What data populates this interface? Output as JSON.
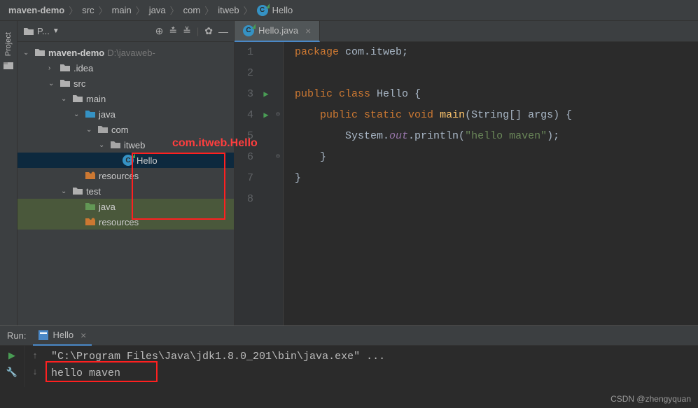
{
  "breadcrumb": [
    "maven-demo",
    "src",
    "main",
    "java",
    "com",
    "itweb",
    "Hello"
  ],
  "panel": {
    "title": "P..."
  },
  "tree": {
    "root": {
      "name": "maven-demo",
      "hint": "D:\\javaweb-"
    },
    "items": [
      {
        "name": ".idea",
        "indent": 1,
        "arrow": ">",
        "color": "#b0b0b0"
      },
      {
        "name": "src",
        "indent": 1,
        "arrow": "v",
        "color": "#b0b0b0"
      },
      {
        "name": "main",
        "indent": 2,
        "arrow": "v",
        "color": "#b0b0b0"
      },
      {
        "name": "java",
        "indent": 3,
        "arrow": "v",
        "color": "#3592c4"
      },
      {
        "name": "com",
        "indent": 4,
        "arrow": "v",
        "color": "#a6a6a6"
      },
      {
        "name": "itweb",
        "indent": 5,
        "arrow": "v",
        "color": "#a6a6a6"
      },
      {
        "name": "Hello",
        "indent": 6,
        "arrow": "",
        "file": true
      },
      {
        "name": "resources",
        "indent": 3,
        "arrow": "",
        "color": "#cc7832"
      },
      {
        "name": "test",
        "indent": 2,
        "arrow": "v",
        "color": "#b0b0b0"
      },
      {
        "name": "java",
        "indent": 3,
        "arrow": "",
        "color": "#629755"
      },
      {
        "name": "resources",
        "indent": 3,
        "arrow": "",
        "color": "#cc7832"
      }
    ]
  },
  "red_annotation": "com.itweb.Hello",
  "tab": {
    "file": "Hello.java"
  },
  "code": {
    "lines": [
      {
        "n": 1,
        "html": "<span class='kw'>package</span> com.itweb;"
      },
      {
        "n": 2,
        "html": ""
      },
      {
        "n": 3,
        "html": "<span class='kw'>public class</span> <span class='cls'>Hello</span> {",
        "run": true
      },
      {
        "n": 4,
        "html": "    <span class='kw'>public static void</span> <span class='mth'>main</span>(String[] args) {",
        "run": true,
        "fold": "⊖"
      },
      {
        "n": 5,
        "html": "        System.<span class='field'>out</span>.println(<span class='str'>\"hello maven\"</span>);"
      },
      {
        "n": 6,
        "html": "    }",
        "fold": "⊖"
      },
      {
        "n": 7,
        "html": "}"
      },
      {
        "n": 8,
        "html": ""
      }
    ]
  },
  "run": {
    "label": "Run:",
    "config": "Hello",
    "cmd": "\"C:\\Program Files\\Java\\jdk1.8.0_201\\bin\\java.exe\" ...",
    "output": "hello maven"
  },
  "rail": {
    "label": "Project"
  },
  "watermark": "CSDN @zhengyquan"
}
